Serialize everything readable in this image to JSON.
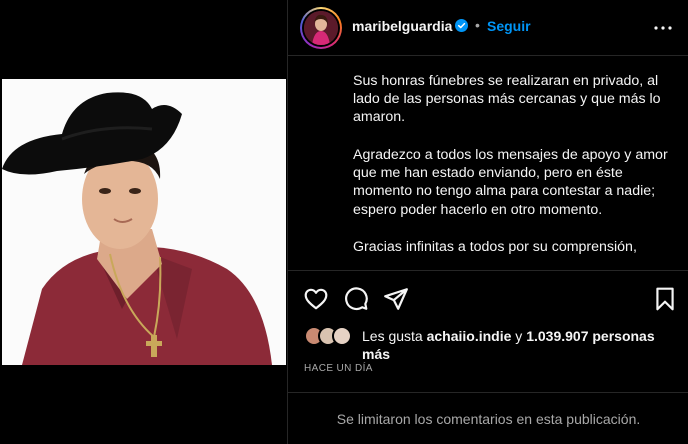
{
  "post": {
    "username": "maribelguardia",
    "separator": "•",
    "follow_label": "Seguir",
    "caption_paragraphs": [
      "Sus honras fúnebres se realizaran en privado, al lado de las personas más cercanas y que más lo amaron.",
      "Agradezco a todos los mensajes de apoyo y amor que me han estado enviando, pero en éste momento no tengo alma para contestar a nadie; espero poder hacerlo en otro momento.",
      "Gracias infinitas a todos por su comprensión,"
    ],
    "likes_prefix": "Les gusta ",
    "likes_user": "achaiio.indie",
    "likes_middle": " y ",
    "likes_count": "1.039.907 personas más",
    "timestamp": "HACE UN DÍA",
    "comments_disabled": "Se limitaron los comentarios en esta publicación."
  },
  "icons": {
    "verified": "verified-badge-icon",
    "more": "more-options-icon",
    "like": "heart-icon",
    "comment": "comment-icon",
    "share": "share-icon",
    "save": "bookmark-icon"
  },
  "colors": {
    "background": "#000000",
    "text": "#f5f5f5",
    "muted": "#a8a8a8",
    "accent": "#0095f6",
    "divider": "#262626",
    "shirt": "#8c2a38"
  }
}
